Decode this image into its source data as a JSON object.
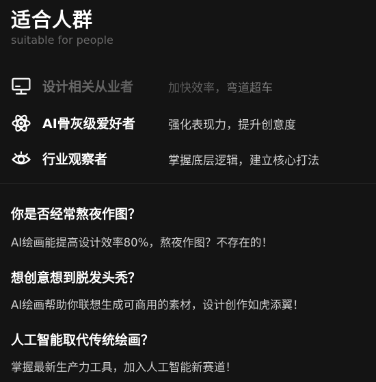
{
  "header": {
    "title": "适合人群",
    "subtitle": "suitable for people"
  },
  "audiences": [
    {
      "icon": "monitor-icon",
      "role": "设计相关从业者",
      "description": "加快效率，弯道超车"
    },
    {
      "icon": "atom-icon",
      "role": "AI骨灰级爱好者",
      "description": "强化表现力，提升创意度"
    },
    {
      "icon": "eye-icon",
      "role": "行业观察者",
      "description": "掌握底层逻辑，建立核心打法"
    }
  ],
  "faqs": [
    {
      "question": "你是否经常熬夜作图？",
      "answer": "AI绘画能提高设计效率80%，熬夜作图？不存在的！"
    },
    {
      "question": "想创意想到脱发头秃？",
      "answer": "AI绘画帮助你联想生成可商用的素材，设计创作如虎添翼！"
    },
    {
      "question": "人工智能取代传统绘画？",
      "answer": "掌握最新生产力工具，加入人工智能新赛道！"
    }
  ],
  "colors": {
    "background": "#141414",
    "text": "#ffffff",
    "muted": "#6a6a6a",
    "answer": "#cfcfcf"
  }
}
